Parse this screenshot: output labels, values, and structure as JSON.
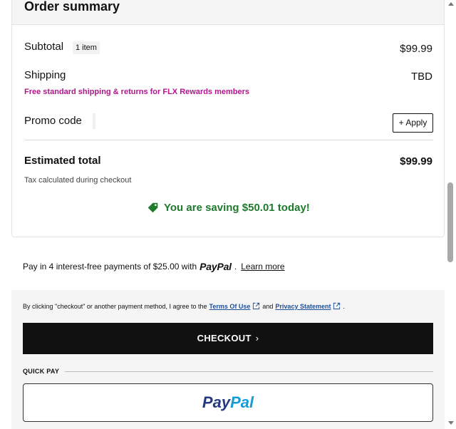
{
  "summary": {
    "title": "Order summary",
    "subtotal_label": "Subtotal",
    "subtotal_badge": "1 item",
    "subtotal_value": "$99.99",
    "shipping_label": "Shipping",
    "shipping_value": "TBD",
    "shipping_note": "Free standard shipping & returns for FLX Rewards members",
    "shipping_note_color": "#b5138b",
    "promo_label": "Promo code",
    "apply_label": "+ Apply",
    "estimated_label": "Estimated total",
    "estimated_value": "$99.99",
    "tax_note": "Tax calculated during checkout",
    "saving_text": "You are saving $50.01 today!",
    "saving_color": "#1f7a2e",
    "saving_icon": "price-tag-icon"
  },
  "paypal_offer": {
    "prefix": "Pay in 4 interest-free payments of $25.00 with",
    "wordmark": "PayPal",
    "suffix": ".",
    "learn_more": "Learn more"
  },
  "checkout": {
    "consent_prefix": "By clicking \"checkout\" or another payment method, I agree to the",
    "terms_link": "Terms Of Use",
    "and_text": "and",
    "privacy_link": "Privacy Statement",
    "period": ".",
    "link_icon": "external-link-icon",
    "checkout_button": "CHECKOUT",
    "checkout_chevron": "›",
    "quick_pay_label": "QUICK PAY",
    "paypal_pay": "Pay",
    "paypal_pal": "Pal",
    "link_color": "#1d4f9a",
    "button_color": "#111111"
  }
}
